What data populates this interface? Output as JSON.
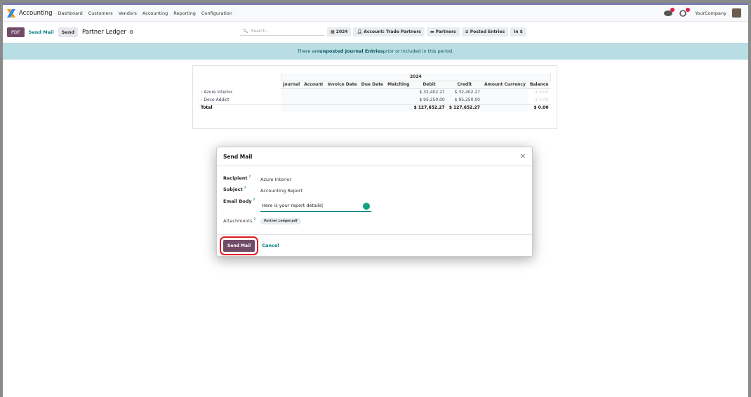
{
  "navbar": {
    "app_name": "Accounting",
    "menu": [
      "Dashboard",
      "Customers",
      "Vendors",
      "Accounting",
      "Reporting",
      "Configuration"
    ],
    "company": "YourCompany"
  },
  "control": {
    "pdf_label": "PDF",
    "send_mail_label": "Send Mail",
    "send_label": "Send",
    "title": "Partner Ledger",
    "search_placeholder": "Search...",
    "filters": [
      "2024",
      "Account: Trade Partners",
      "Partners",
      "Posted Entries",
      "In $"
    ]
  },
  "banner": {
    "prefix": "There are ",
    "bold": "unposted Journal Entries",
    "suffix": " prior or included in this period."
  },
  "report": {
    "period": "2024",
    "columns": [
      "Journal",
      "Account",
      "Invoice Date",
      "Due Date",
      "Matching",
      "Debit",
      "Credit",
      "Amount Currency",
      "Balance"
    ],
    "rows": [
      {
        "name": "Azure Interior",
        "debit": "$ 32,402.27",
        "credit": "$ 32,402.27",
        "balance": "$ 0.00"
      },
      {
        "name": "Deco Addict",
        "debit": "$ 95,250.00",
        "credit": "$ 95,250.00",
        "balance": "$ 0.00"
      }
    ],
    "total": {
      "name": "Total",
      "debit": "$ 127,652.27",
      "credit": "$ 127,652.27",
      "balance": "$ 0.00"
    }
  },
  "modal": {
    "title": "Send Mail",
    "recipient_label": "Recipient",
    "recipient_value": "Azure Interior",
    "subject_label": "Subject",
    "subject_value": "Accounting Report",
    "body_label": "Email Body",
    "body_value": "Here is your report details|",
    "attachments_label": "Attachments",
    "attachment_name": "Partner Ledger.pdf",
    "send_button": "Send Mail",
    "cancel_button": "Cancel",
    "help_mark": "?"
  },
  "colors": {
    "brand": "#714b67",
    "link": "#017e84",
    "banner_bg": "#b8dde2",
    "highlight": "#e11d24"
  }
}
